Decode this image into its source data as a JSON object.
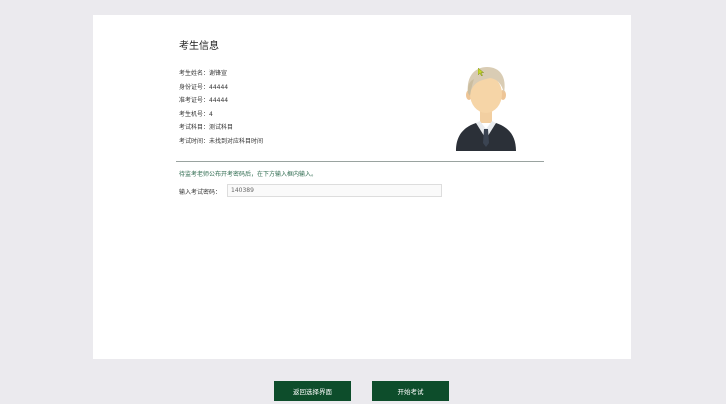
{
  "page": {
    "title": "考生信息"
  },
  "candidate": {
    "rows": [
      {
        "label": "考生姓名：",
        "value": "谢锋宣"
      },
      {
        "label": "身份证号：",
        "value": "44444"
      },
      {
        "label": "准考证号：",
        "value": "44444"
      },
      {
        "label": "考生机号：",
        "value": "4"
      },
      {
        "label": "考试科目：",
        "value": "测试科目"
      },
      {
        "label": "考试时间：",
        "value": "未找到对应科目时间"
      }
    ]
  },
  "notice": {
    "text": "待监考老师公布开考密码后，在下方输入框内输入。"
  },
  "password": {
    "label": "输入考试密码：",
    "value": "140389"
  },
  "buttons": {
    "back": "返回选择界面",
    "start": "开始考试"
  },
  "icons": {
    "avatar": "user-avatar-icon",
    "cursor": "mouse-cursor-icon"
  },
  "colors": {
    "background": "#ebeaee",
    "panel": "#ffffff",
    "button": "#0d4d2b",
    "notice": "#2e6b4f",
    "divider": "#9aa3a0"
  }
}
